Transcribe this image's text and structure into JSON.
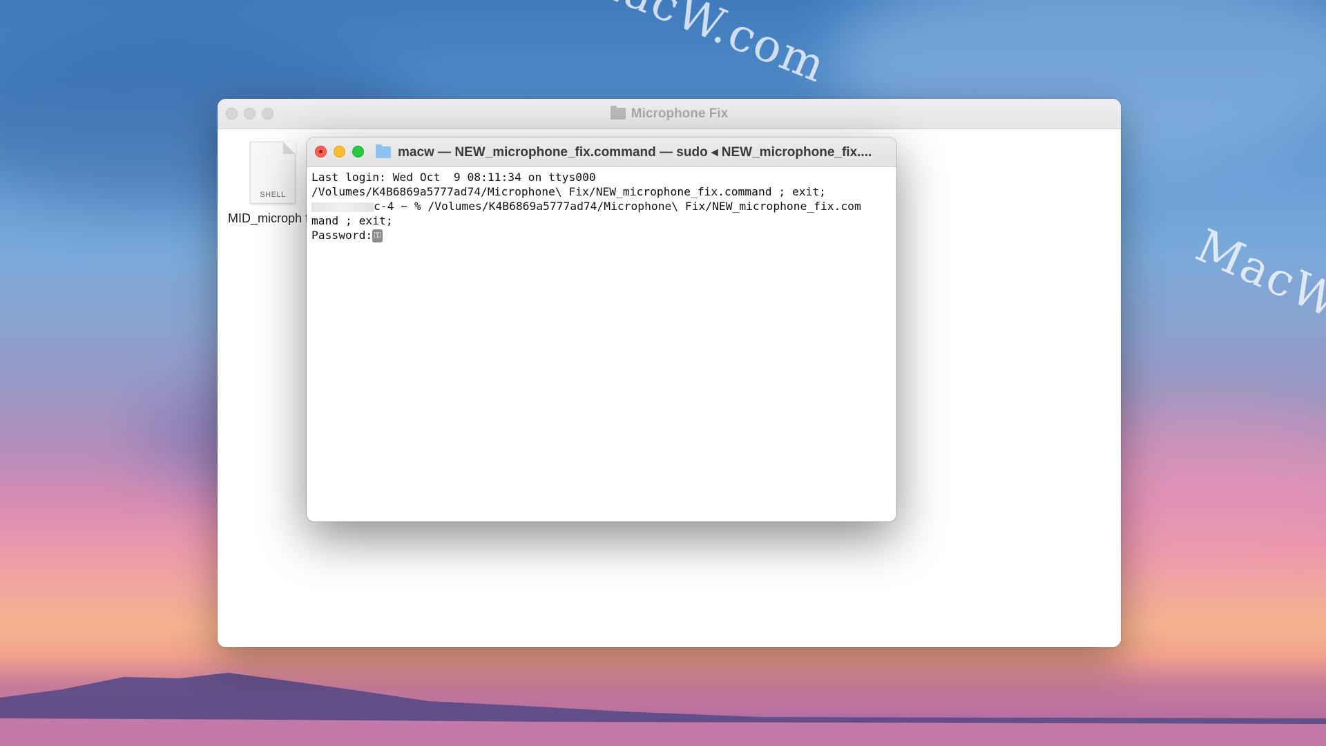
{
  "watermark": "MacW.com",
  "finder": {
    "title": "Microphone Fix",
    "file": {
      "icon_label": "SHELL",
      "name": "MID_microph fix"
    }
  },
  "terminal": {
    "title": "macw — NEW_microphone_fix.command — sudo ◂ NEW_microphone_fix....",
    "lines": [
      "Last login: Wed Oct  9 08:11:34 on ttys000",
      "/Volumes/K4B6869a5777ad74/Microphone\\ Fix/NEW_microphone_fix.command ; exit;",
      "c-4 ~ % /Volumes/K4B6869a5777ad74/Microphone\\ Fix/NEW_microphone_fix.com",
      "mand ; exit;",
      "Password:"
    ]
  },
  "colors": {
    "close": "#fe5f57",
    "minimize": "#febc2e",
    "zoom": "#28c840"
  }
}
